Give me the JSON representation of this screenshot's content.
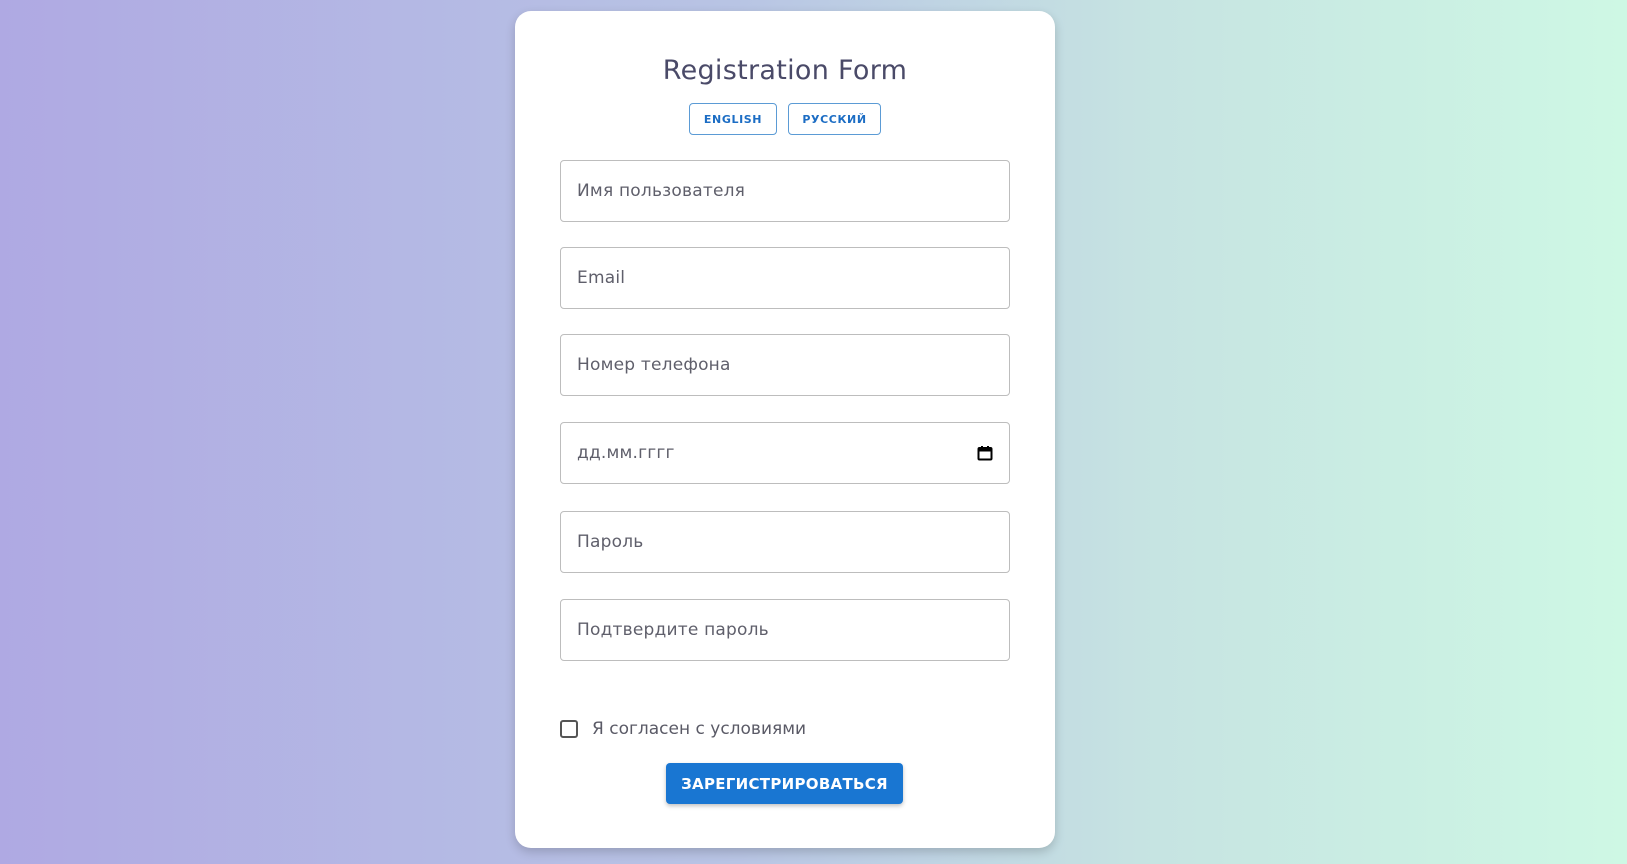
{
  "form": {
    "title": "Registration Form",
    "languages": {
      "english": "ENGLISH",
      "russian": "РУССКИЙ"
    },
    "fields": {
      "username_placeholder": "Имя пользователя",
      "email_placeholder": "Email",
      "phone_placeholder": "Номер телефона",
      "date_placeholder": "дд.мм.гггг",
      "password_placeholder": "Пароль",
      "confirm_password_placeholder": "Подтвердите пароль"
    },
    "terms_label": "Я согласен с условиями",
    "terms_checked": false,
    "submit_label": "ЗАРЕГИСТРИРОВАТЬСЯ"
  },
  "colors": {
    "accent": "#1976d2",
    "title": "#4a4a68",
    "background_left": "#afa9e3",
    "background_right": "#cef8e4"
  },
  "icons": {
    "date_picker": "calendar-icon"
  }
}
